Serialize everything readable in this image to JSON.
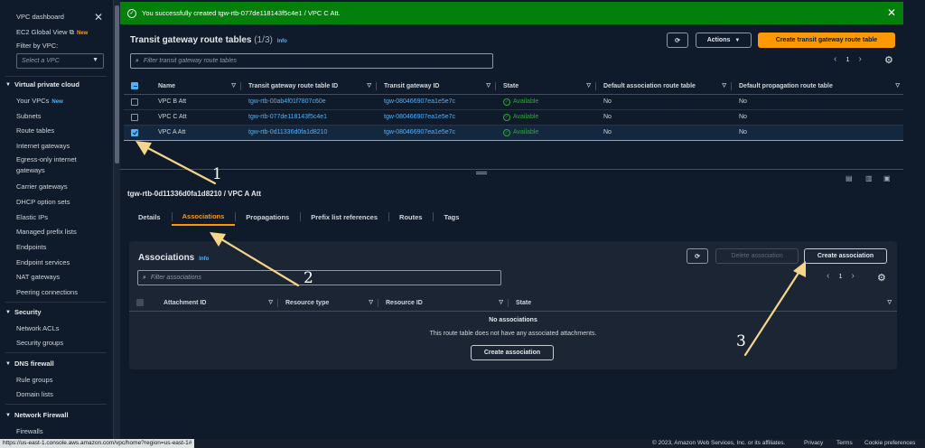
{
  "sidebar": {
    "dashboard": "VPC dashboard",
    "ec2_global_view": "EC2 Global View",
    "new_label": "New",
    "filter_label": "Filter by VPC:",
    "select_placeholder": "Select a VPC",
    "section_vpc": "Virtual private cloud",
    "items_vpc": [
      "Your VPCs",
      "Subnets",
      "Route tables",
      "Internet gateways",
      "Egress-only internet gateways",
      "Carrier gateways",
      "DHCP option sets",
      "Elastic IPs",
      "Managed prefix lists",
      "Endpoints",
      "Endpoint services",
      "NAT gateways",
      "Peering connections"
    ],
    "section_security": "Security",
    "items_security": [
      "Network ACLs",
      "Security groups"
    ],
    "section_dns": "DNS firewall",
    "items_dns": [
      "Rule groups",
      "Domain lists"
    ],
    "section_nfw": "Network Firewall",
    "items_nfw": [
      "Firewalls"
    ]
  },
  "flash": {
    "message": "You successfully created tgw-rtb-077de118143f5c4e1 / VPC C Att."
  },
  "top": {
    "title": "Transit gateway route tables",
    "count": "(1/3)",
    "info": "Info",
    "actions": "Actions",
    "create_button": "Create transit gateway route table",
    "search_placeholder": "Filter transit gateway route tables",
    "page": "1",
    "columns": [
      "Name",
      "Transit gateway route table ID",
      "Transit gateway ID",
      "State",
      "Default association route table",
      "Default propagation route table"
    ],
    "rows": [
      {
        "name": "VPC B Att",
        "rtb": "tgw-rtb-00ab4f01f7807c60e",
        "tgw": "tgw-080466907ea1e5e7c",
        "state": "Available",
        "assoc": "No",
        "prop": "No"
      },
      {
        "name": "VPC C Att",
        "rtb": "tgw-rtb-077de118143f5c4e1",
        "tgw": "tgw-080466907ea1e5e7c",
        "state": "Available",
        "assoc": "No",
        "prop": "No"
      },
      {
        "name": "VPC A Att",
        "rtb": "tgw-rtb-0d11336d0fa1d8210",
        "tgw": "tgw-080466907ea1e5e7c",
        "state": "Available",
        "assoc": "No",
        "prop": "No"
      }
    ]
  },
  "detail": {
    "title": "tgw-rtb-0d11336d0fa1d8210 / VPC A Att",
    "tabs": [
      "Details",
      "Associations",
      "Propagations",
      "Prefix list references",
      "Routes",
      "Tags"
    ],
    "active_tab": "Associations"
  },
  "assoc": {
    "title": "Associations",
    "info": "Info",
    "delete_button": "Delete association",
    "create_button": "Create association",
    "search_placeholder": "Filter associations",
    "page": "1",
    "columns": [
      "Attachment ID",
      "Resource type",
      "Resource ID",
      "State"
    ],
    "empty_title": "No associations",
    "empty_desc": "This route table does not have any associated attachments.",
    "empty_button": "Create association"
  },
  "annotations": [
    "1",
    "2",
    "3"
  ],
  "status": {
    "url": "https://us-east-1.console.aws.amazon.com/vpc/home?region=us-east-1#",
    "copyright": "© 2023, Amazon Web Services, Inc. or its affiliates.",
    "privacy": "Privacy",
    "terms": "Terms",
    "cookies": "Cookie preferences"
  },
  "colors": {
    "accent": "#ff9900",
    "link": "#4db3ff",
    "success": "#037f0c",
    "available": "#29ad32",
    "annotation": "#f5d58a"
  }
}
